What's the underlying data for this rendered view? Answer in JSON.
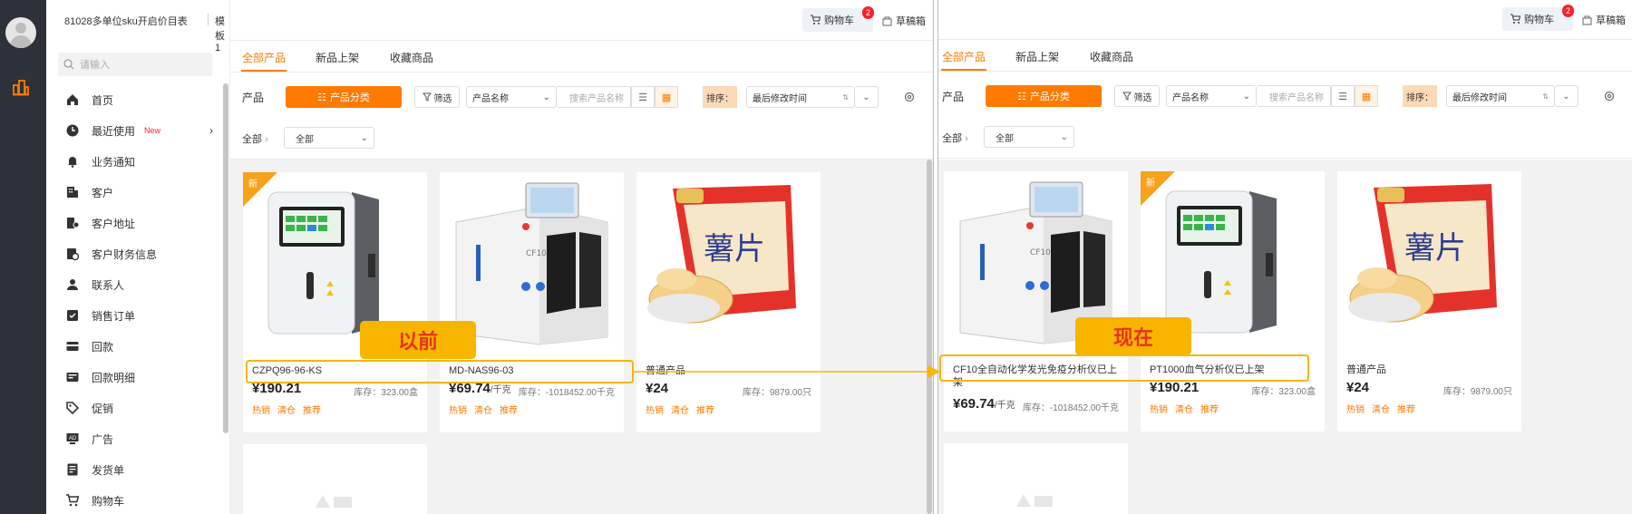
{
  "header": {
    "title": "81028多单位sku开启价目表",
    "template": "模板1",
    "cart_label": "购物车",
    "cart_count": "2",
    "draft_label": "草稿箱"
  },
  "sidebar": {
    "search_placeholder": "请输入",
    "items": [
      {
        "label": "首页",
        "icon": "home-icon"
      },
      {
        "label": "最近使用",
        "icon": "clock-icon",
        "badge": "New",
        "arrow": "›"
      },
      {
        "label": "业务通知",
        "icon": "bell-icon"
      },
      {
        "label": "客户",
        "icon": "building-icon"
      },
      {
        "label": "客户地址",
        "icon": "address-icon"
      },
      {
        "label": "客户财务信息",
        "icon": "finance-icon"
      },
      {
        "label": "联系人",
        "icon": "contact-icon"
      },
      {
        "label": "销售订单",
        "icon": "order-icon"
      },
      {
        "label": "回款",
        "icon": "payment-icon"
      },
      {
        "label": "回款明细",
        "icon": "payment-detail-icon"
      },
      {
        "label": "促销",
        "icon": "tag-icon"
      },
      {
        "label": "广告",
        "icon": "ad-icon"
      },
      {
        "label": "发货单",
        "icon": "invoice-icon"
      },
      {
        "label": "购物车",
        "icon": "cart-icon"
      }
    ]
  },
  "tabs": [
    "全部产品",
    "新品上架",
    "收藏商品"
  ],
  "toolbar": {
    "product_label": "产品",
    "category_button": "产品分类",
    "filter_button": "筛选",
    "field_select": "产品名称",
    "search_placeholder": "搜索产品名称",
    "sort_label": "排序：",
    "sort_value": "最后修改时间"
  },
  "breadcrumb": {
    "root": "全部",
    "select_value": "全部"
  },
  "before_label": "以前",
  "after_label": "现在",
  "before_products": [
    {
      "name": "CZPQ96-96-KS",
      "price": "¥190.21",
      "unit": "",
      "stock": "库存：323.00盒",
      "tags": [
        "热销",
        "清仓",
        "推荐"
      ],
      "is_new": true,
      "new_text": "新",
      "image": "analyzer"
    },
    {
      "name": "MD-NAS96-03",
      "price": "¥69.74",
      "unit": "/千克",
      "stock": "库存：-1018452.00千克",
      "tags": [
        "热销",
        "清仓",
        "推荐"
      ],
      "is_new": false,
      "image": "machine"
    },
    {
      "name": "普通产品",
      "price": "¥24",
      "unit": "",
      "stock": "库存：9879.00只",
      "tags": [
        "热销",
        "清仓",
        "推荐"
      ],
      "is_new": false,
      "image": "chips"
    }
  ],
  "after_products": [
    {
      "name": "CF10全自动化学发光免疫分析仪已上架",
      "price": "¥69.74",
      "unit": "/千克",
      "stock": "库存：-1018452.00千克",
      "tags": [],
      "is_new": false,
      "image": "machine"
    },
    {
      "name": "PT1000血气分析仪已上架",
      "price": "¥190.21",
      "unit": "",
      "stock": "库存：323.00盒",
      "tags": [
        "热销",
        "清仓",
        "推荐"
      ],
      "is_new": true,
      "new_text": "新",
      "image": "analyzer"
    },
    {
      "name": "普通产品",
      "price": "¥24",
      "unit": "",
      "stock": "库存：9879.00只",
      "tags": [
        "热销",
        "清仓",
        "推荐"
      ],
      "is_new": false,
      "image": "chips"
    }
  ],
  "chips_text": "薯片",
  "colors": {
    "accent": "#ff7a00",
    "highlight": "#f7b500",
    "label_text": "#e5331b",
    "nav_dark": "#2d3139"
  }
}
